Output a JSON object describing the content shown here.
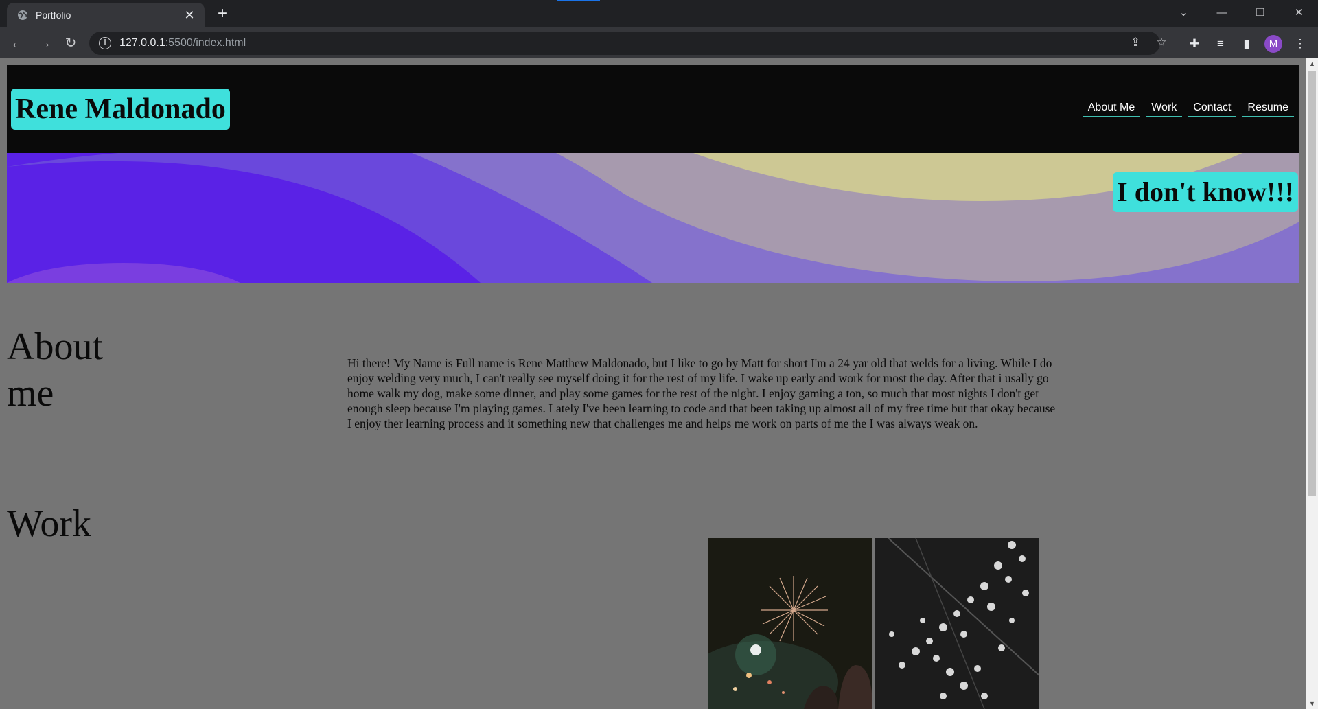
{
  "browser": {
    "tab_title": "Portfolio",
    "url_host": "127.0.0.1",
    "url_path": ":5500/index.html",
    "profile_initial": "M"
  },
  "site": {
    "name": "Rene Maldonado",
    "nav": [
      "About Me",
      "Work",
      "Contact",
      "Resume"
    ],
    "tagline": "I don't know!!!"
  },
  "about": {
    "title_line1": "About",
    "title_line2": "me",
    "text": "Hi there! My Name is Full name is Rene Matthew Maldonado, but I like to go by Matt for short I'm a 24 yar old that welds for a living. While I do enjoy welding very much, I can't really see myself doing it for the rest of my life. I wake up early and work for most the day. After that i usally go home walk my dog, make some dinner, and play some games for the rest of the night. I enjoy gaming a ton, so much that most nights I don't get enough sleep because I'm playing games. Lately I've been learning to code and that been taking up almost all of my free time but that okay because I enjoy ther learning process and it something new that challenges me and helps me work on parts of me the I was always weak on."
  },
  "work": {
    "title": "Work",
    "images": [
      "fireworks-photo",
      "cherry-blossom-photo"
    ]
  },
  "colors": {
    "accent": "#3fe0dc",
    "header_bg": "#0a0a0a",
    "page_bg": "#757575"
  }
}
